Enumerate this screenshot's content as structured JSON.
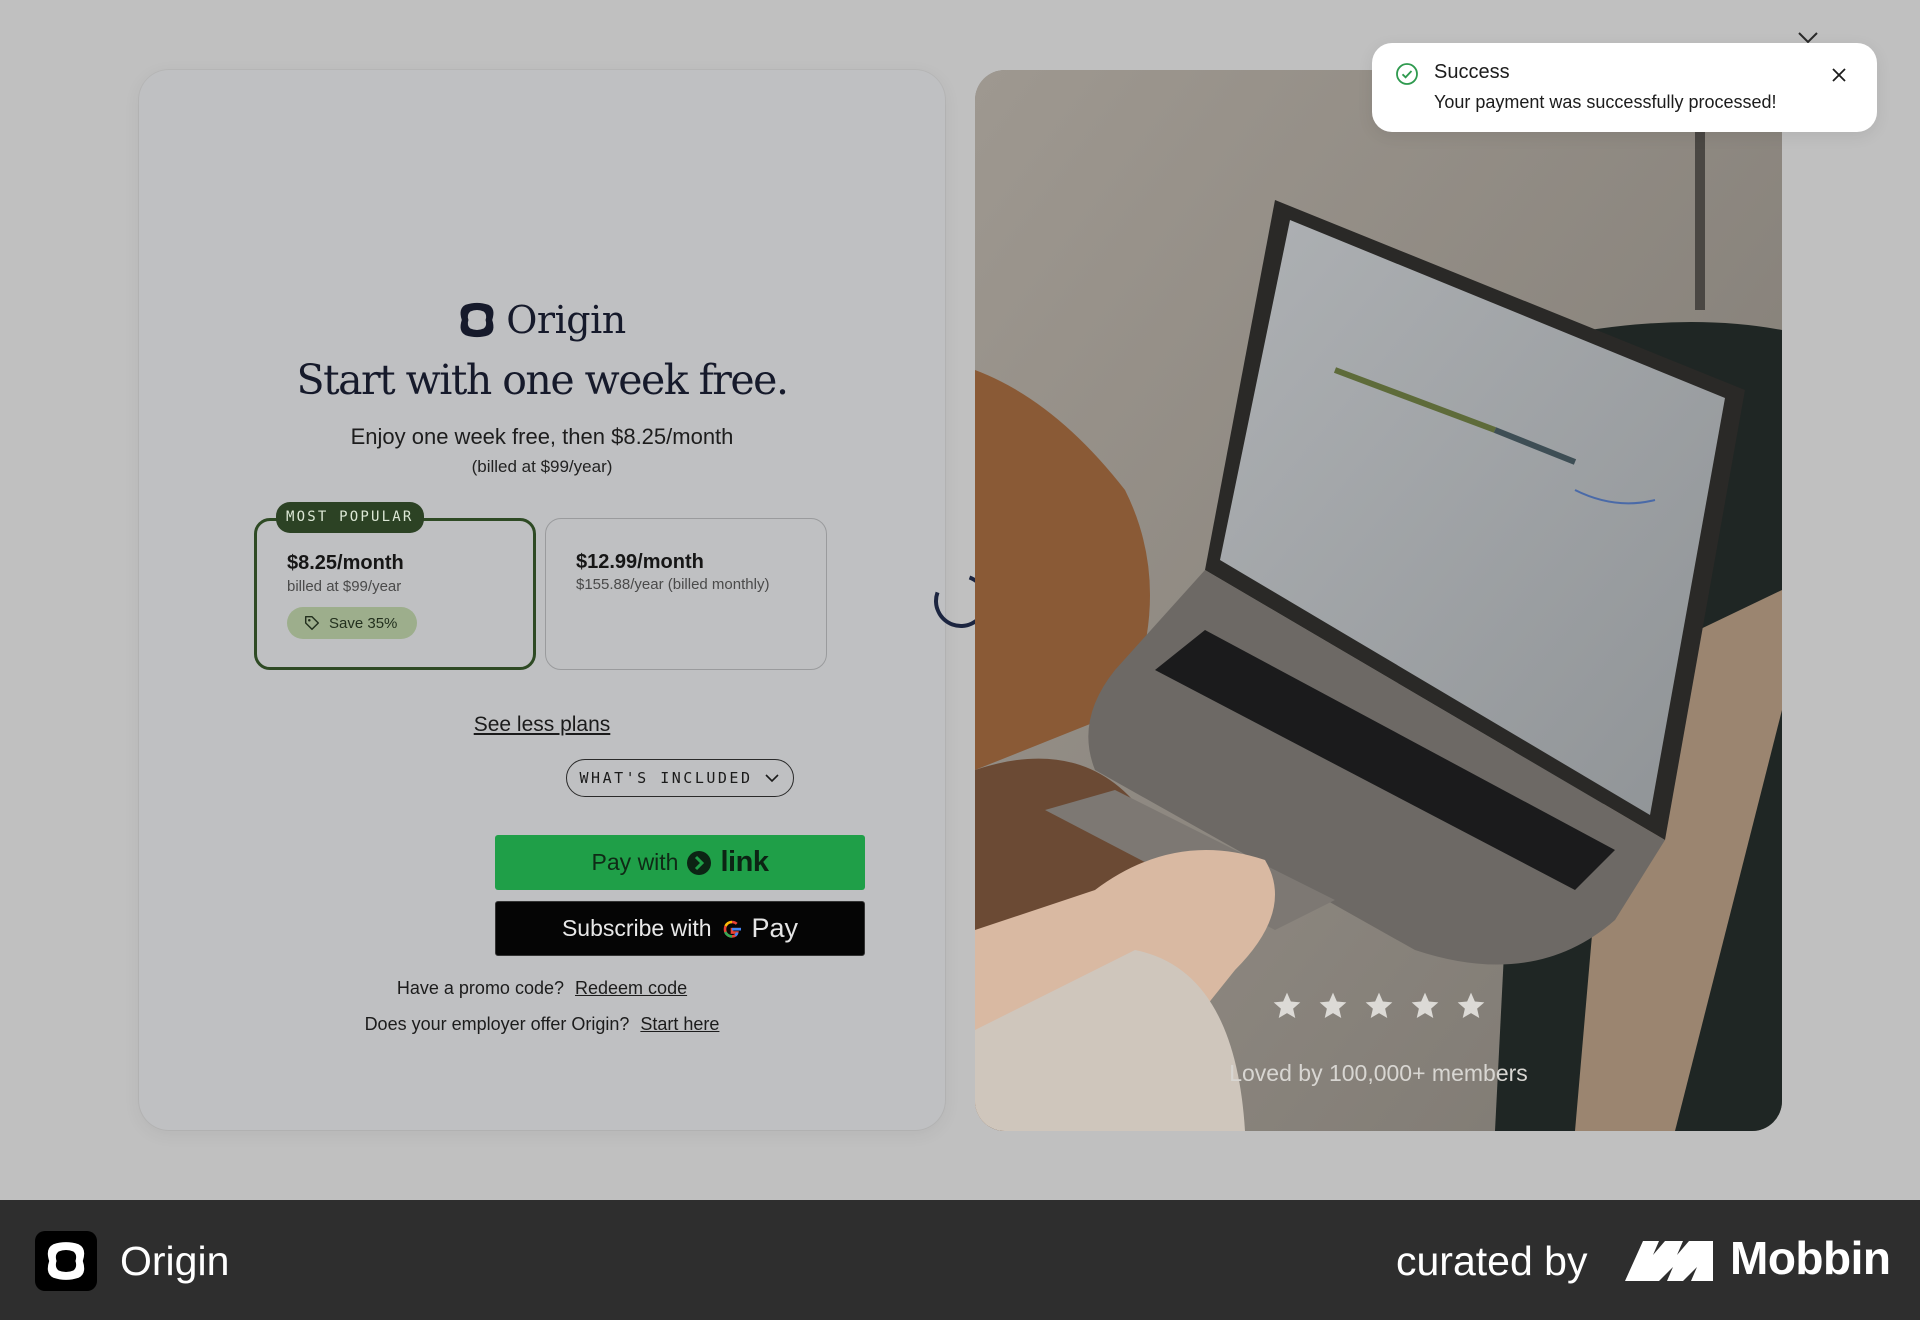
{
  "brand": {
    "name": "Origin"
  },
  "hero": {
    "headline": "Start with one week free.",
    "subtitle": "Enjoy one week free, then $8.25/month",
    "billing_note": "(billed at $99/year)"
  },
  "plans": [
    {
      "badge": "MOST POPULAR",
      "price": "$8.25/month",
      "note": "billed at $99/year",
      "save": "Save 35%",
      "selected": true
    },
    {
      "price": "$12.99/month",
      "note": "$155.88/year (billed monthly)",
      "selected": false
    }
  ],
  "see_less_label": "See less plans",
  "whats_included_label": "WHAT'S INCLUDED",
  "pay_link": {
    "prefix": "Pay with",
    "word": "link"
  },
  "pay_gpay": {
    "prefix": "Subscribe with",
    "word": "Pay"
  },
  "promo": {
    "text": "Have a promo code?",
    "link": "Redeem code"
  },
  "employer": {
    "text": "Does your employer offer Origin?",
    "link": "Start here"
  },
  "testimonial": {
    "rating": 5,
    "text": "Loved by 100,000+ members"
  },
  "toast": {
    "title": "Success",
    "message": "Your payment was successfully processed!"
  },
  "footer": {
    "app_name": "Origin",
    "curated_by": "curated by",
    "curator": "Mobbin"
  },
  "colors": {
    "link_green": "#1f9f48",
    "plan_border": "#2e4a24",
    "save_pill": "#9dae8c",
    "success_green": "#2f9a4f"
  }
}
